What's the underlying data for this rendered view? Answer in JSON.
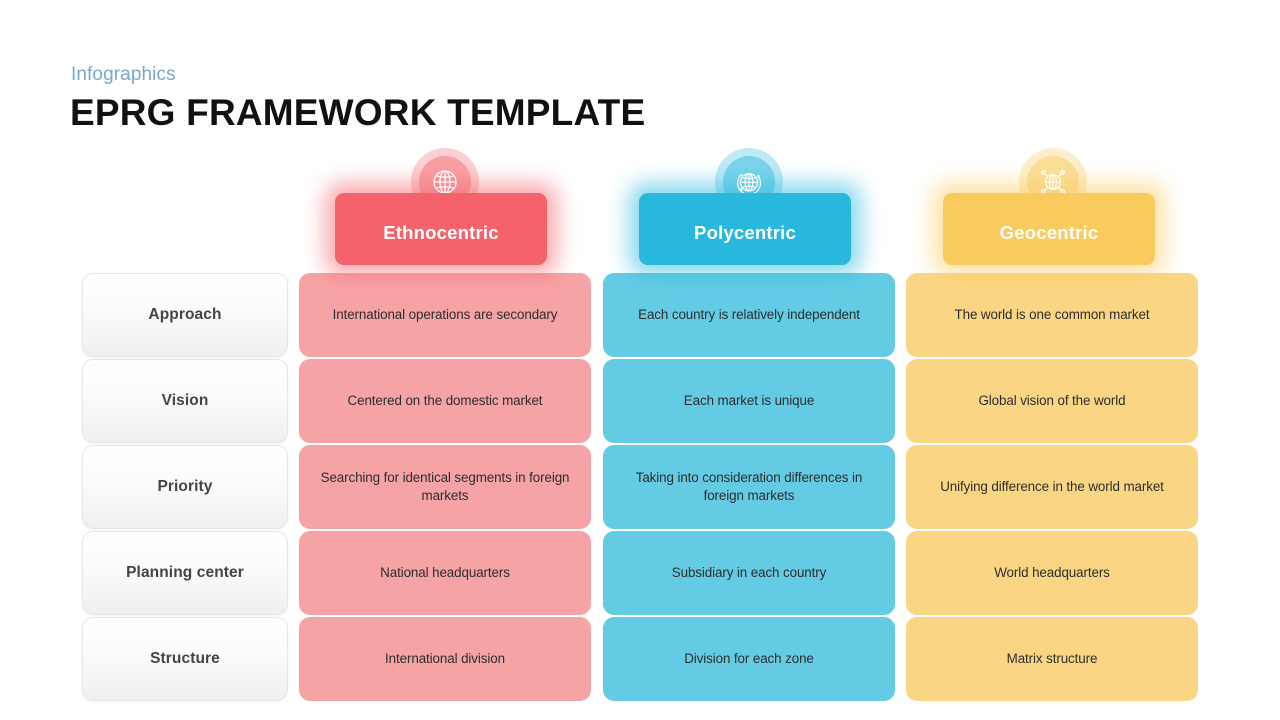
{
  "header": {
    "eyebrow": "Infographics",
    "title": "EPRG FRAMEWORK TEMPLATE"
  },
  "colors": {
    "eyebrow": "#7BA7CC",
    "title": "#111111",
    "background": "#FFFFFF",
    "ethnocentric_header": "#F4636B",
    "polycentric_header": "#28B8DE",
    "geocentric_header": "#F9CB5E",
    "ethnocentric_cell": "#F6A3A5",
    "polycentric_cell": "#64CBE4",
    "geocentric_cell": "#FAD684",
    "label_text": "#444444",
    "cell_text": "#2D2D2D"
  },
  "columns": [
    {
      "key": "ethnocentric",
      "label": "Ethnocentric",
      "icon": "globe-icon"
    },
    {
      "key": "polycentric",
      "label": "Polycentric",
      "icon": "globe-orbit-icon"
    },
    {
      "key": "geocentric",
      "label": "Geocentric",
      "icon": "globe-network-icon"
    }
  ],
  "rows": [
    {
      "label": "Approach",
      "cells": [
        "International operations are secondary",
        "Each country is relatively independent",
        "The world is one common market"
      ]
    },
    {
      "label": "Vision",
      "cells": [
        "Centered on the domestic market",
        "Each market is unique",
        "Global vision of the world"
      ]
    },
    {
      "label": "Priority",
      "cells": [
        "Searching for identical segments in foreign markets",
        "Taking into consideration differences in foreign markets",
        "Unifying difference in the world market"
      ]
    },
    {
      "label": "Planning center",
      "cells": [
        "National headquarters",
        "Subsidiary in each country",
        "World headquarters"
      ]
    },
    {
      "label": "Structure",
      "cells": [
        "International division",
        "Division for each zone",
        "Matrix structure"
      ]
    }
  ]
}
